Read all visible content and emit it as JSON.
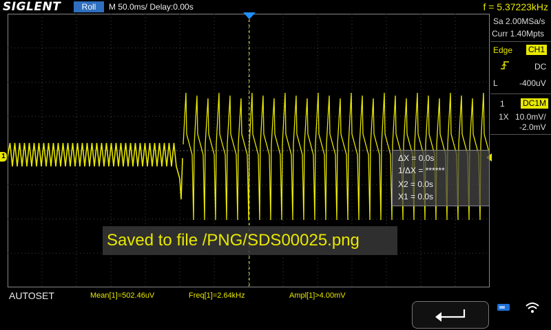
{
  "header": {
    "logo": "SIGLENT",
    "mode": "Roll",
    "timebase": "M 50.0ms/ Delay:0.00s",
    "frequency": "f = 5.37223kHz"
  },
  "acquisition": {
    "sample_rate": "Sa 2.00MSa/s",
    "memory": "Curr 1.40Mpts"
  },
  "trigger": {
    "type": "Edge",
    "source": "CH1",
    "coupling": "DC",
    "level_label": "L",
    "level": "-400uV"
  },
  "channel": {
    "number": "1",
    "coupling": "DC1M",
    "probe": "1X",
    "scale": "10.0mV/",
    "offset": "-2.0mV",
    "marker": "1"
  },
  "cursors": {
    "dx": "ΔX = 0.0s",
    "inv_dx": "1/ΔX = ******",
    "x2": "X2 = 0.0s",
    "x1": "X1 = 0.0s"
  },
  "message": "Saved to file /PNG/SDS00025.png",
  "footer": {
    "autoset": "AUTOSET",
    "measurements": [
      "Mean[1]=502.46uV",
      "Freq[1]=2.64kHz",
      "Ampl[1]>4.00mV"
    ]
  },
  "colors": {
    "trace": "#e8e800",
    "accent_blue": "#2f6fbf",
    "trigger_marker": "#1e90ff"
  },
  "icons": [
    "back-arrow-icon",
    "usb-icon",
    "wifi-icon",
    "trigger-rising-edge-icon"
  ]
}
